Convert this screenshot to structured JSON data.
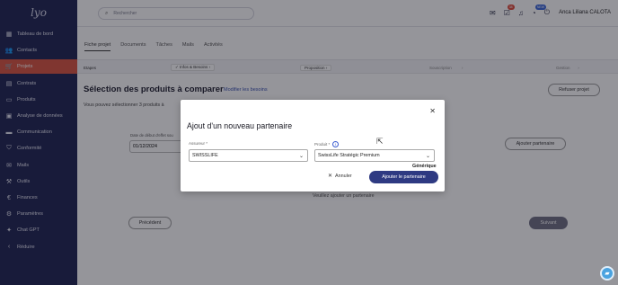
{
  "app": {
    "logo_text": "lyo"
  },
  "sidebar": {
    "items": [
      {
        "icon": "dashboard-icon",
        "glyph": "▦",
        "label": "Tableau de bord"
      },
      {
        "icon": "contacts-icon",
        "glyph": "👥",
        "label": "Contacts"
      },
      {
        "icon": "cart-icon",
        "glyph": "🛒",
        "label": "Projets",
        "active": true
      },
      {
        "icon": "document-icon",
        "glyph": "▤",
        "label": "Contrats"
      },
      {
        "icon": "products-icon",
        "glyph": "▭",
        "label": "Produits"
      },
      {
        "icon": "analytics-icon",
        "glyph": "▣",
        "label": "Analyse de données"
      },
      {
        "icon": "communication-icon",
        "glyph": "▬",
        "label": "Communication"
      },
      {
        "icon": "compliance-icon",
        "glyph": "⛉",
        "label": "Conformité"
      },
      {
        "icon": "mail-icon",
        "glyph": "✉",
        "label": "Mails"
      },
      {
        "icon": "tools-icon",
        "glyph": "⚒",
        "label": "Outils"
      },
      {
        "icon": "euro-icon",
        "glyph": "€",
        "label": "Finances"
      },
      {
        "icon": "gear-icon",
        "glyph": "⚙",
        "label": "Paramètres"
      },
      {
        "icon": "chatgpt-icon",
        "glyph": "✦",
        "label": "Chat GPT"
      },
      {
        "icon": "chevron-left-icon",
        "glyph": "‹",
        "label": "Réduire"
      }
    ]
  },
  "header": {
    "search_placeholder": "Rechercher",
    "badges": {
      "tasks": "38",
      "notifications": "NEW"
    },
    "user_name": "Anca Liliana CALOTA"
  },
  "main": {
    "tabs": [
      {
        "label": "Fiche projet",
        "active": true
      },
      {
        "label": "Documents"
      },
      {
        "label": "Tâches"
      },
      {
        "label": "Mails"
      },
      {
        "label": "Activités"
      }
    ],
    "stepper": {
      "label": "Etapes",
      "steps": [
        "Infos & Besoins",
        "Proposition",
        "Souscription",
        "Gestion"
      ]
    },
    "section_title": "Sélection des produits à comparer",
    "modify_link": "Modifier les besoins",
    "refuse_button": "Refuser projet",
    "hint": "Vous pouvez sélectionner 3 produits à",
    "date_label": "Date de début d'effet sou",
    "date_value": "01/12/2024",
    "add_partner_button": "Ajouter partenaire",
    "partner_hint": "Veuillez ajouter un partenaire",
    "prev_button": "Précédent",
    "next_button": "Suivant"
  },
  "modal": {
    "title": "Ajout d'un nouveau partenaire",
    "assureur_label": "Assureur *",
    "assureur_value": "SWISSLIFE",
    "produit_label": "Produit *",
    "produit_value": "SwissLife Stratégic Premium",
    "generic_label": "Générique",
    "cancel_label": "Annuler",
    "add_label": "Ajouter le partenaire"
  }
}
